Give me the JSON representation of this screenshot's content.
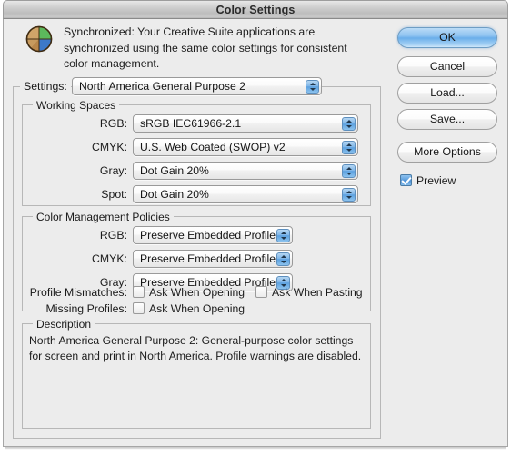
{
  "window": {
    "title": "Color Settings"
  },
  "header": {
    "icon": "globe-color-icon",
    "message": "Synchronized: Your Creative Suite applications are synchronized using the same color settings for consistent color management."
  },
  "settings": {
    "label": "Settings:",
    "value": "North America General Purpose 2"
  },
  "working_spaces": {
    "legend": "Working Spaces",
    "rows": [
      {
        "label": "RGB:",
        "value": "sRGB IEC61966-2.1"
      },
      {
        "label": "CMYK:",
        "value": "U.S. Web Coated (SWOP) v2"
      },
      {
        "label": "Gray:",
        "value": "Dot Gain 20%"
      },
      {
        "label": "Spot:",
        "value": "Dot Gain 20%"
      }
    ]
  },
  "policies": {
    "legend": "Color Management Policies",
    "rows": [
      {
        "label": "RGB:",
        "value": "Preserve Embedded Profiles"
      },
      {
        "label": "CMYK:",
        "value": "Preserve Embedded Profiles"
      },
      {
        "label": "Gray:",
        "value": "Preserve Embedded Profiles"
      }
    ],
    "mismatches_label": "Profile Mismatches:",
    "mismatch_opening": "Ask When Opening",
    "mismatch_pasting": "Ask When Pasting",
    "missing_label": "Missing Profiles:",
    "missing_opening": "Ask When Opening",
    "mismatch_opening_checked": false,
    "mismatch_pasting_checked": false,
    "missing_opening_checked": false
  },
  "description": {
    "legend": "Description",
    "text": "North America General Purpose 2:  General-purpose color settings for screen and print in North America. Profile warnings are disabled."
  },
  "buttons": {
    "ok": "OK",
    "cancel": "Cancel",
    "load": "Load...",
    "save": "Save...",
    "more_options": "More Options"
  },
  "preview": {
    "label": "Preview",
    "checked": true
  },
  "colors": {
    "dialog_bg": "#ececec",
    "accent_blue": "#5a9ddd",
    "text": "#1a1a1a",
    "group_border": "#b7b7b7"
  }
}
